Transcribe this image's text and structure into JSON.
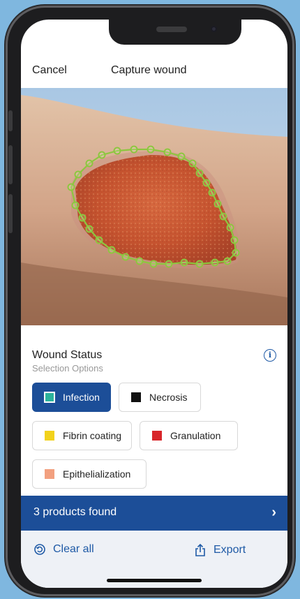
{
  "header": {
    "cancel_label": "Cancel",
    "title": "Capture wound"
  },
  "photo": {
    "description_icon": "wound-photo"
  },
  "wound_status": {
    "title": "Wound Status",
    "subtitle": "Selection Options",
    "info_icon": "info-icon",
    "options": [
      {
        "label": "Infection",
        "color": "#2bb39c",
        "selected": true
      },
      {
        "label": "Necrosis",
        "color": "#111111",
        "selected": false
      },
      {
        "label": "Fibrin coating",
        "color": "#f2d21b",
        "selected": false
      },
      {
        "label": "Granulation",
        "color": "#d8262a",
        "selected": false
      },
      {
        "label": "Epithelialization",
        "color": "#f2a07f",
        "selected": false
      }
    ]
  },
  "results": {
    "label": "3 products found",
    "chevron_icon": "chevron-right-icon"
  },
  "footer": {
    "clear_label": "Clear all",
    "export_label": "Export"
  },
  "colors": {
    "accent": "#1c4e98",
    "link": "#1f5aa6",
    "outline": "#8dc63f"
  }
}
